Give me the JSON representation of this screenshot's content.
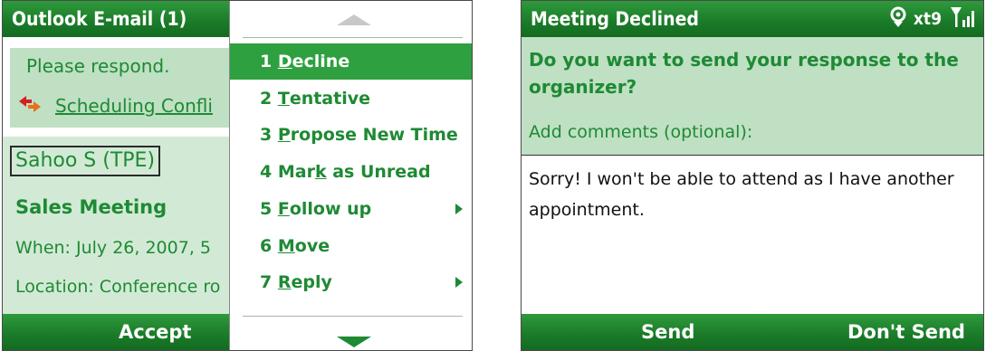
{
  "left_screen": {
    "title": "Outlook E-mail (1)",
    "respond_text": "Please respond.",
    "scheduling_link": "Scheduling Confli",
    "sender": "Sahoo S (TPE)",
    "subject": "Sales Meeting",
    "when": "When: July 26, 2007, 5",
    "location": "Location: Conference ro",
    "softkey_left": "Accept"
  },
  "menu": {
    "items": [
      {
        "num": "1 ",
        "hot": "D",
        "rest": "ecline",
        "selected": true
      },
      {
        "num": "2 ",
        "hot": "T",
        "rest": "entative"
      },
      {
        "num": "3 ",
        "hot": "P",
        "rest": "ropose New Time"
      },
      {
        "num": "4 Mar",
        "hot": "k",
        "rest": " as Unread"
      },
      {
        "num": "5 ",
        "hot": "F",
        "rest": "ollow up",
        "submenu": true
      },
      {
        "num": "6 ",
        "hot": "M",
        "rest": "ove"
      },
      {
        "num": "7 ",
        "hot": "R",
        "rest": "eply",
        "submenu": true
      }
    ]
  },
  "right_screen": {
    "title": "Meeting Declined",
    "status_xt9": "xt9",
    "question": "Do you want to send your response to the organizer?",
    "add_comments_label": "Add comments (optional):",
    "comment": "Sorry! I won't be able to attend as I have another appointment.",
    "softkey_left": "Send",
    "softkey_right": "Don't Send"
  },
  "colors": {
    "accent_green": "#1e8a34",
    "bar_green": "#1a7a28",
    "panel_green": "#bfe0c3",
    "selected_green": "#2ea03f"
  },
  "icons": {
    "scheduling": "scheduling-conflict-icon",
    "location": "location-pin-icon",
    "signal": "signal-strength-icon",
    "scroll_up": "menu-scroll-up-icon",
    "scroll_down": "menu-scroll-down-icon"
  }
}
